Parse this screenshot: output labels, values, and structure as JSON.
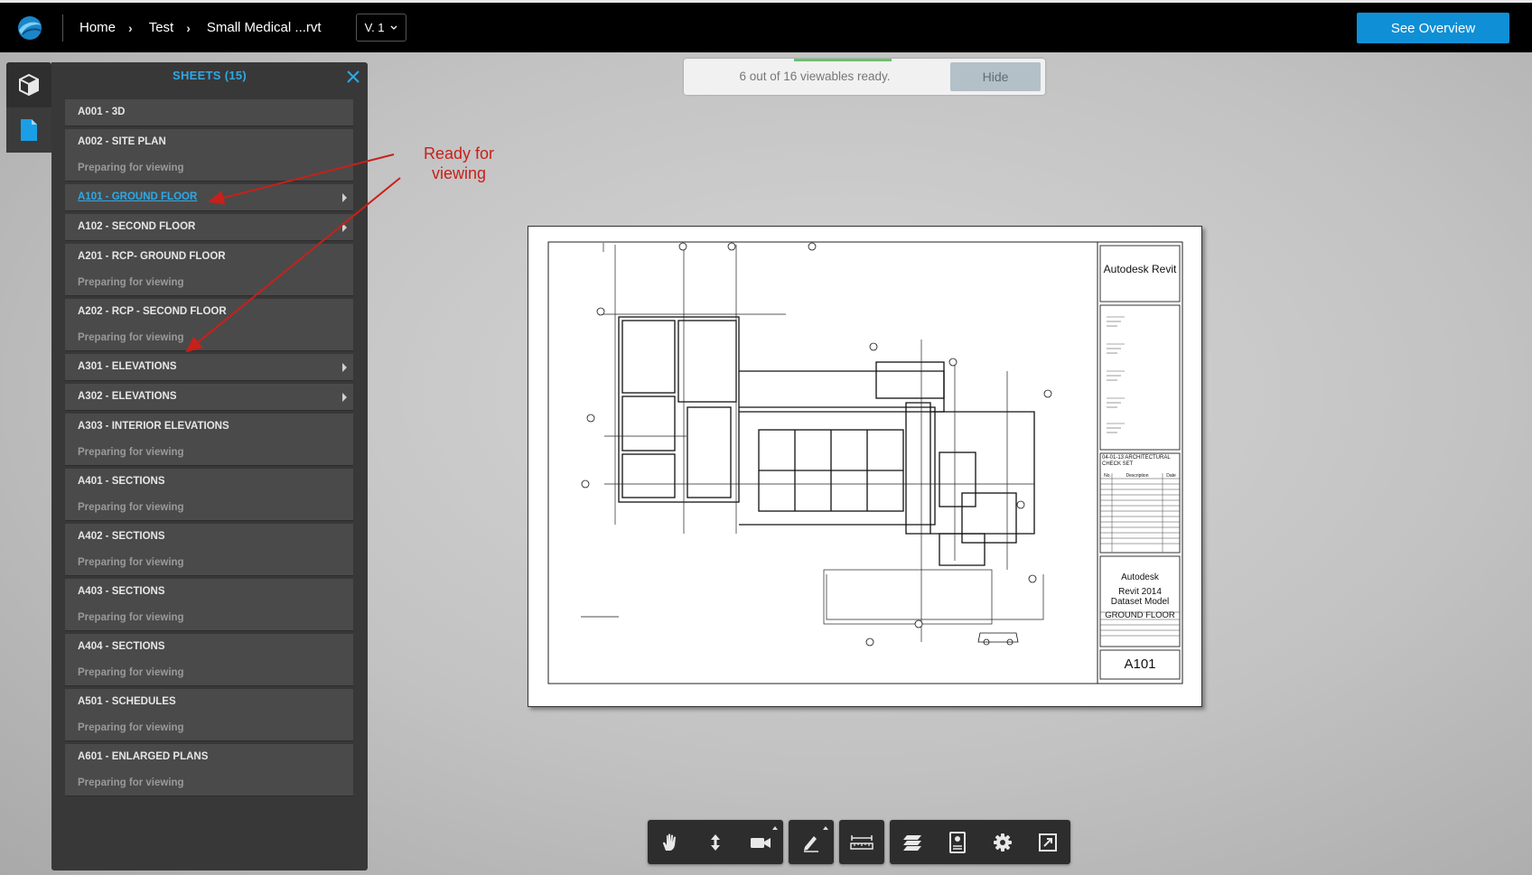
{
  "header": {
    "breadcrumbs": [
      "Home",
      "Test",
      "Small Medical ...rvt"
    ],
    "version": "V. 1",
    "overview_button": "See Overview"
  },
  "viewables": {
    "message": "6 out of 16 viewables ready.",
    "hide_label": "Hide"
  },
  "sheets_panel": {
    "title": "SHEETS (15)",
    "sheets": [
      {
        "name": "A001 - 3D",
        "status": "",
        "selected": false,
        "expandable": false
      },
      {
        "name": "A002 - SITE PLAN",
        "status": "Preparing for viewing",
        "selected": false,
        "expandable": false
      },
      {
        "name": "A101 - GROUND FLOOR",
        "status": "",
        "selected": true,
        "expandable": true
      },
      {
        "name": "A102 - SECOND FLOOR",
        "status": "",
        "selected": false,
        "expandable": true
      },
      {
        "name": "A201 - RCP- GROUND FLOOR",
        "status": "Preparing for viewing",
        "selected": false,
        "expandable": false
      },
      {
        "name": "A202 - RCP - SECOND FLOOR",
        "status": "Preparing for viewing",
        "selected": false,
        "expandable": false
      },
      {
        "name": "A301 - ELEVATIONS",
        "status": "",
        "selected": false,
        "expandable": true
      },
      {
        "name": "A302 - ELEVATIONS",
        "status": "",
        "selected": false,
        "expandable": true
      },
      {
        "name": "A303 - INTERIOR ELEVATIONS",
        "status": "Preparing for viewing",
        "selected": false,
        "expandable": false
      },
      {
        "name": "A401 - SECTIONS",
        "status": "Preparing for viewing",
        "selected": false,
        "expandable": false
      },
      {
        "name": "A402 - SECTIONS",
        "status": "Preparing for viewing",
        "selected": false,
        "expandable": false
      },
      {
        "name": "A403 - SECTIONS",
        "status": "Preparing for viewing",
        "selected": false,
        "expandable": false
      },
      {
        "name": "A404 - SECTIONS",
        "status": "Preparing for viewing",
        "selected": false,
        "expandable": false
      },
      {
        "name": "A501 - SCHEDULES",
        "status": "Preparing for viewing",
        "selected": false,
        "expandable": false
      },
      {
        "name": "A601 - ENLARGED PLANS",
        "status": "Preparing for viewing",
        "selected": false,
        "expandable": false
      }
    ]
  },
  "annotation": {
    "line1": "Ready for",
    "line2": "viewing",
    "color": "#c8201a"
  },
  "drawing": {
    "title_block": {
      "brand": "Autodesk Revit",
      "issue": "04-01-13 ARCHITECTURAL CHECK SET",
      "col_no": "No.",
      "col_description": "Description",
      "col_date": "Date",
      "company": "Autodesk",
      "project_line1": "Revit 2014",
      "project_line2": "Dataset Model",
      "sheet_title": "GROUND FLOOR",
      "sheet_number": "A101"
    }
  },
  "toolbar": {
    "icons": [
      "pan-icon",
      "dolly-icon",
      "camera-icon",
      "markup-icon",
      "measure-icon",
      "layers-icon",
      "properties-icon",
      "settings-icon",
      "fullscreen-icon"
    ]
  },
  "colors": {
    "accent": "#0f8fd6",
    "panel": "#383838",
    "sheet_item": "#4a4a4a",
    "selected_link": "#2fa8e6",
    "progress": "#68c36a"
  }
}
